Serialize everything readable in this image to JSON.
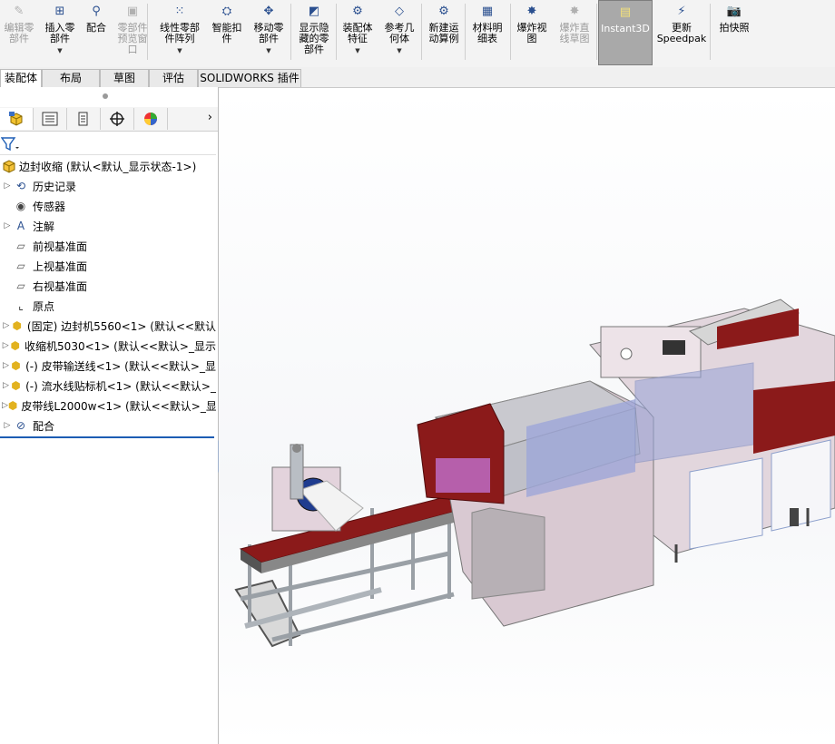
{
  "ribbon": {
    "buttons": [
      {
        "label": "编辑零\n部件",
        "icon": "edit-component-icon",
        "disabled": true,
        "arrow": false
      },
      {
        "label": "插入零\n部件",
        "icon": "insert-components-icon",
        "disabled": false,
        "arrow": true
      },
      {
        "label": "配合",
        "icon": "mate-icon",
        "disabled": false,
        "arrow": false
      },
      {
        "label": "零部件\n预览窗\n口",
        "icon": "component-preview-icon",
        "disabled": true,
        "arrow": false
      },
      {
        "label": "线性零部\n件阵列",
        "icon": "linear-pattern-icon",
        "disabled": false,
        "arrow": true
      },
      {
        "label": "智能扣\n件",
        "icon": "smart-fasteners-icon",
        "disabled": false,
        "arrow": false
      },
      {
        "label": "移动零\n部件",
        "icon": "move-component-icon",
        "disabled": false,
        "arrow": true
      },
      {
        "label": "显示隐\n藏的零\n部件",
        "icon": "show-hidden-icon",
        "disabled": false,
        "arrow": false
      },
      {
        "label": "装配体\n特征",
        "icon": "assembly-features-icon",
        "disabled": false,
        "arrow": true
      },
      {
        "label": "参考几\n何体",
        "icon": "reference-geometry-icon",
        "disabled": false,
        "arrow": true
      },
      {
        "label": "新建运\n动算例",
        "icon": "motion-study-icon",
        "disabled": false,
        "arrow": false
      },
      {
        "label": "材料明\n细表",
        "icon": "bom-icon",
        "disabled": false,
        "arrow": false
      },
      {
        "label": "爆炸视\n图",
        "icon": "exploded-view-icon",
        "disabled": false,
        "arrow": false
      },
      {
        "label": "爆炸直\n线草图",
        "icon": "explode-line-sketch-icon",
        "disabled": true,
        "arrow": false
      },
      {
        "label": "Instant3D",
        "icon": "instant3d-icon",
        "disabled": false,
        "arrow": false,
        "active": true
      },
      {
        "label": "更新\nSpeedpak",
        "icon": "speedpak-icon",
        "disabled": false,
        "arrow": false
      },
      {
        "label": "拍快照",
        "icon": "snapshot-icon",
        "disabled": false,
        "arrow": false
      }
    ]
  },
  "tabs": [
    "装配体",
    "布局",
    "草图",
    "评估",
    "SOLIDWORKS 插件"
  ],
  "panel_tabs": [
    "featuremanager-icon",
    "propertymanager-icon",
    "configurationmanager-icon",
    "dimxpertmanager-icon",
    "displaymanager-icon"
  ],
  "tree": {
    "root": "边封收缩 (默认<默认_显示状态-1>)",
    "items": [
      {
        "label": "历史记录",
        "icon": "history-icon",
        "expandable": true
      },
      {
        "label": "传感器",
        "icon": "sensor-icon",
        "expandable": false
      },
      {
        "label": "注解",
        "icon": "annotation-icon",
        "expandable": true
      },
      {
        "label": "前视基准面",
        "icon": "plane-icon",
        "expandable": false
      },
      {
        "label": "上视基准面",
        "icon": "plane-icon",
        "expandable": false
      },
      {
        "label": "右视基准面",
        "icon": "plane-icon",
        "expandable": false
      },
      {
        "label": "原点",
        "icon": "origin-icon",
        "expandable": false
      },
      {
        "label": "(固定) 边封机5560<1> (默认<<默认",
        "icon": "subassembly-icon",
        "expandable": true
      },
      {
        "label": "收缩机5030<1> (默认<<默认>_显示",
        "icon": "subassembly-icon",
        "expandable": true
      },
      {
        "label": "(-) 皮带输送线<1> (默认<<默认>_显",
        "icon": "subassembly-icon",
        "expandable": true
      },
      {
        "label": "(-) 流水线贴标机<1> (默认<<默认>_",
        "icon": "subassembly-icon",
        "expandable": true
      },
      {
        "label": "皮带线L2000w<1> (默认<<默认>_显",
        "icon": "subassembly-icon",
        "expandable": true
      },
      {
        "label": "配合",
        "icon": "mates-folder-icon",
        "expandable": true
      }
    ]
  },
  "heads_up_toolbar": [
    "zoom-to-fit-icon",
    "zoom-to-area-icon",
    "previous-view-icon",
    "section-view-icon",
    "view-orientation-icon"
  ],
  "colors": {
    "ribbon_bg": "#f3f3f3",
    "active_button_bg": "#a9a9a9",
    "rollback_bar": "#1c5cb3",
    "machine_red": "#8b1a1a",
    "machine_body": "#e9dde3"
  }
}
